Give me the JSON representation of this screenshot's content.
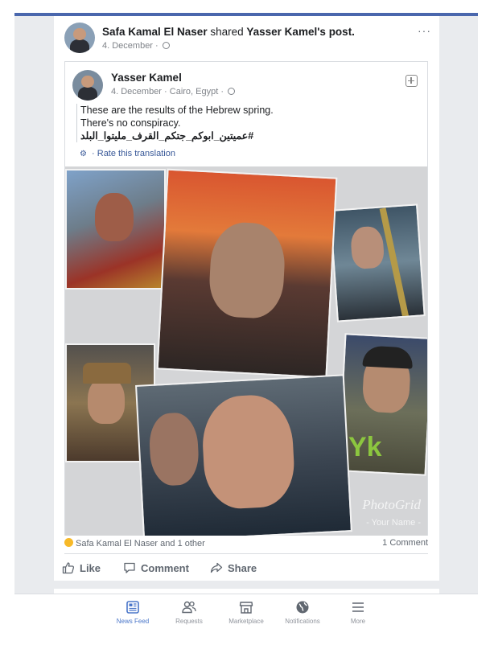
{
  "shared_by": {
    "name": "Safa Kamal El Naser",
    "action_text": "shared",
    "original_author": "Yasser Kamel",
    "post_suffix": "'s post.",
    "date": "4. December"
  },
  "post": {
    "author": "Yasser Kamel",
    "date": "4. December",
    "location": "Cairo, Egypt",
    "text_line1": "These are the results of the Hebrew spring.",
    "text_line2": "There's no conspiracy.",
    "hashtag": "#عميتين_ابوكم_جتكم_القرف_مليتوا_البلد",
    "rate_translation": "Rate this translation"
  },
  "collage": {
    "overlay_text": "Yk",
    "watermark": "PhotoGrid",
    "watermark_sub": "- Your Name -"
  },
  "reactions": {
    "summary": "Safa Kamal El Naser and 1 other",
    "comments": "1 Comment"
  },
  "actions": {
    "like": "Like",
    "comment": "Comment",
    "share": "Share"
  },
  "tabs": [
    {
      "label": "News Feed",
      "icon": "news-feed-icon",
      "active": true
    },
    {
      "label": "Requests",
      "icon": "friends-icon",
      "active": false
    },
    {
      "label": "Marketplace",
      "icon": "marketplace-icon",
      "active": false
    },
    {
      "label": "Notifications",
      "icon": "globe-icon",
      "active": false
    },
    {
      "label": "More",
      "icon": "menu-icon",
      "active": false
    }
  ],
  "colors": {
    "accent": "#4a76c9",
    "header_bar": "#4a67ad",
    "yk_green": "#8cc63f"
  }
}
